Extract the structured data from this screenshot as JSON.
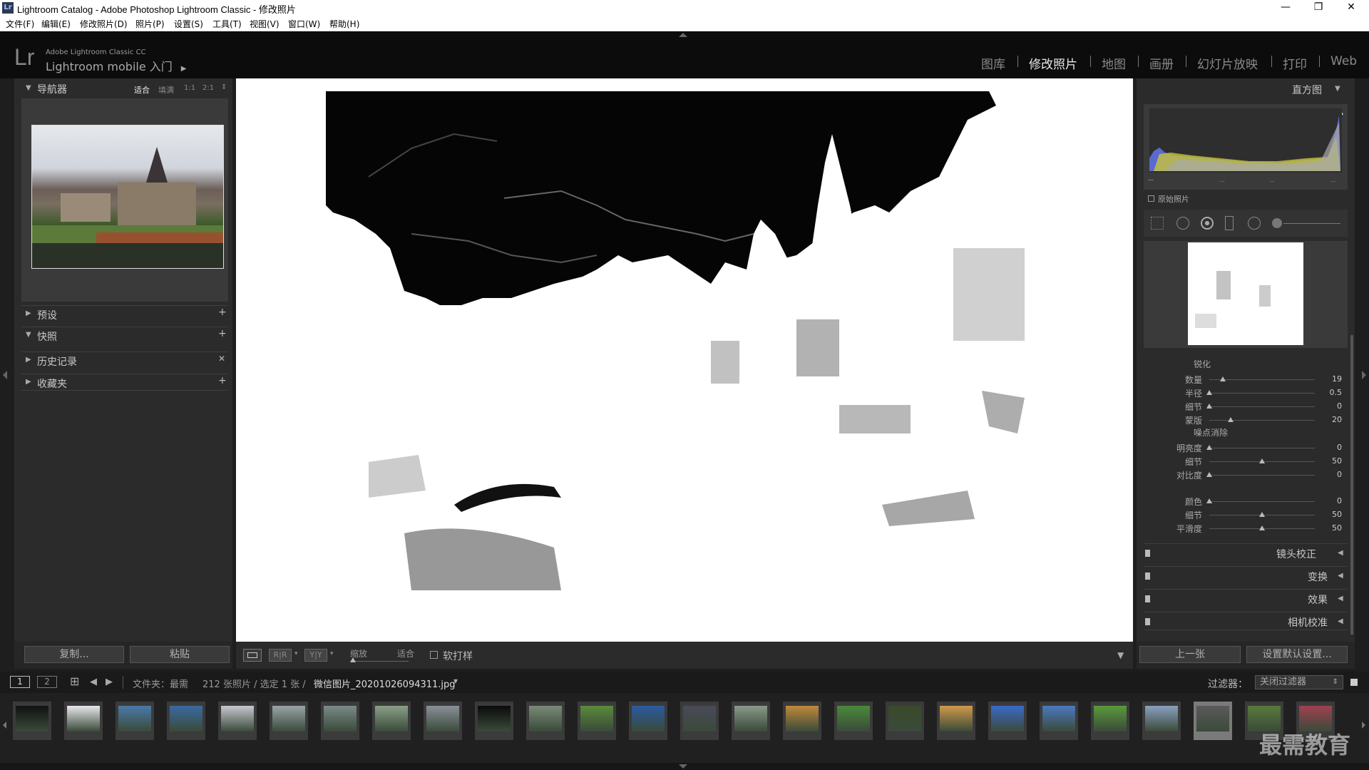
{
  "window": {
    "title": "Lightroom Catalog - Adobe Photoshop Lightroom Classic - 修改照片",
    "logo": "Lr",
    "controls": [
      "—",
      "❐",
      "✕"
    ]
  },
  "menu": [
    "文件(F)",
    "编辑(E)",
    "修改照片(D)",
    "照片(P)",
    "设置(S)",
    "工具(T)",
    "视图(V)",
    "窗口(W)",
    "帮助(H)"
  ],
  "identity": {
    "mark": "Lr",
    "product": "Adobe Lightroom Classic CC",
    "mobile": "Lightroom mobile 入门",
    "arrow": "▶"
  },
  "modules": [
    "图库",
    "修改照片",
    "地图",
    "画册",
    "幻灯片放映",
    "打印",
    "Web"
  ],
  "active_module": "修改照片",
  "navigator": {
    "title": "导航器",
    "zoom": [
      "适合",
      "填满",
      "1:1",
      "2:1"
    ]
  },
  "left_panels": [
    {
      "label": "预设",
      "action": "+"
    },
    {
      "label": "快照",
      "action": "+"
    },
    {
      "label": "历史记录",
      "action": "✕"
    },
    {
      "label": "收藏夹",
      "action": "+"
    }
  ],
  "left_buttons": {
    "copy": "复制...",
    "paste": "粘贴"
  },
  "toolbar": {
    "zoom_label": "缩放",
    "fit_label": "适合",
    "soft_proof": "软打样",
    "rr": "R|R",
    "yy": "Y|Y"
  },
  "histogram": {
    "title": "直方图",
    "original_photo": "原始照片",
    "ticks": [
      "—",
      "—",
      "—",
      "—"
    ]
  },
  "sharpening": {
    "title": "锐化",
    "rows": [
      {
        "label": "数量",
        "value": "19",
        "pos": 0.13
      },
      {
        "label": "半径",
        "value": "0.5",
        "pos": 0.0
      },
      {
        "label": "细节",
        "value": "0",
        "pos": 0.0
      },
      {
        "label": "蒙版",
        "value": "20",
        "pos": 0.2
      }
    ]
  },
  "noise": {
    "title": "噪点消除",
    "rows": [
      {
        "label": "明亮度",
        "value": "0",
        "pos": 0.0
      },
      {
        "label": "细节",
        "value": "50",
        "pos": 0.5
      },
      {
        "label": "对比度",
        "value": "0",
        "pos": 0.0
      },
      {
        "label": "颜色",
        "value": "0",
        "pos": 0.0
      },
      {
        "label": "细节",
        "value": "50",
        "pos": 0.5
      },
      {
        "label": "平滑度",
        "value": "50",
        "pos": 0.5
      }
    ]
  },
  "right_sections": [
    "镜头校正",
    "变换",
    "效果",
    "相机校准"
  ],
  "right_buttons": {
    "prev": "上一张",
    "reset": "设置默认设置..."
  },
  "filmstrip_bar": {
    "screen1": "1",
    "screen2": "2",
    "grid_icon": "⊞",
    "back": "◀",
    "forward": "▶",
    "path": "文件夹：最需",
    "count": "212 张照片 / 选定 1 张 /",
    "filename": "微信图片_20201026094311.jpg",
    "dropdown": "▾",
    "filter_label": "过滤器：",
    "filter_value": "关闭过滤器"
  },
  "watermark": "最需教育",
  "colors": {
    "accent": "#cfcfcf",
    "panel": "#2b2b2b",
    "bg": "#1e1e1e",
    "active_tab": "#e8e8e8"
  }
}
